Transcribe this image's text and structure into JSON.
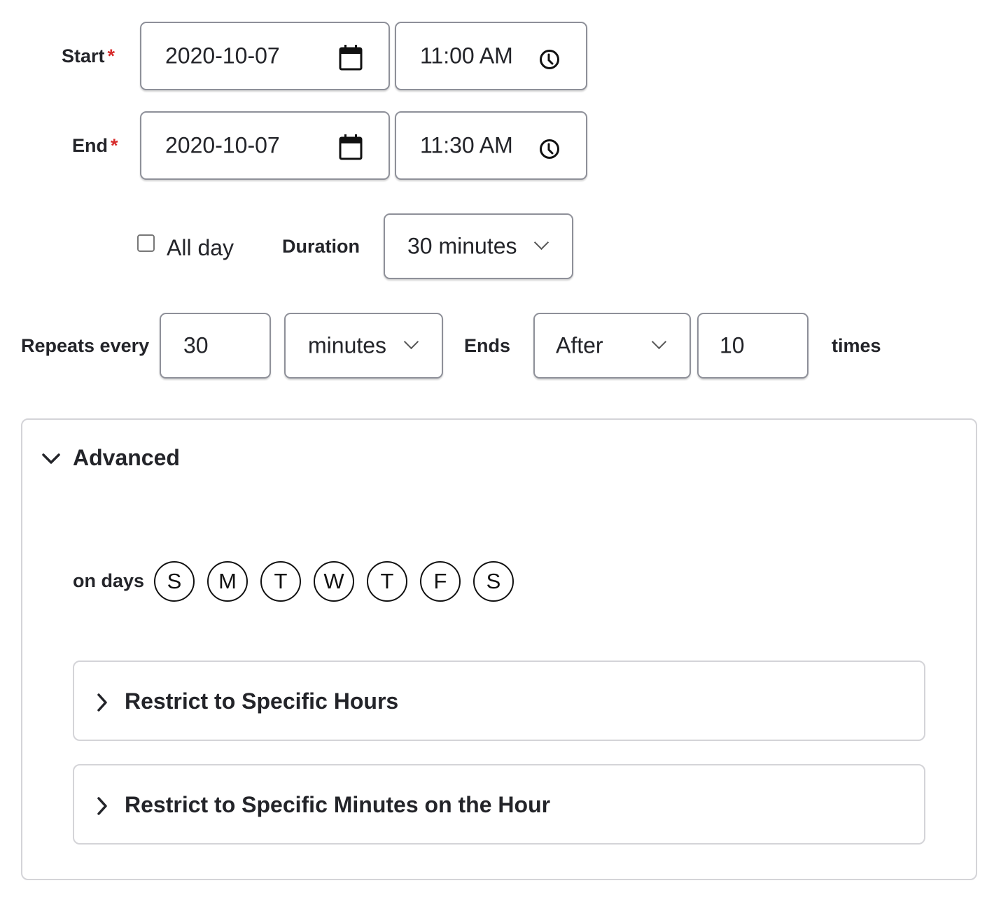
{
  "start": {
    "label": "Start",
    "required_mark": "*",
    "date": "2020-10-07",
    "time": "11:00 AM",
    "date_icon": "calendar-icon",
    "time_icon": "clock-icon"
  },
  "end": {
    "label": "End",
    "required_mark": "*",
    "date": "2020-10-07",
    "time": "11:30 AM",
    "date_icon": "calendar-icon",
    "time_icon": "clock-icon"
  },
  "all_day": {
    "label": "All day",
    "checked": false
  },
  "duration": {
    "label": "Duration",
    "selected": "30 minutes"
  },
  "repeat": {
    "label": "Repeats every",
    "interval": "30",
    "unit_selected": "minutes",
    "ends_label": "Ends",
    "ends_selected": "After",
    "count": "10",
    "times_label": "times"
  },
  "advanced": {
    "title": "Advanced",
    "expanded": true,
    "on_days_label": "on days",
    "days": [
      "S",
      "M",
      "T",
      "W",
      "T",
      "F",
      "S"
    ],
    "sections": [
      {
        "title": "Restrict to Specific Hours",
        "expanded": false
      },
      {
        "title": "Restrict to Specific Minutes on the Hour",
        "expanded": false
      }
    ]
  },
  "colors": {
    "text": "#232429",
    "required": "#d72b2b",
    "field_border": "#8e9099",
    "panel_border": "#d4d4d8"
  }
}
